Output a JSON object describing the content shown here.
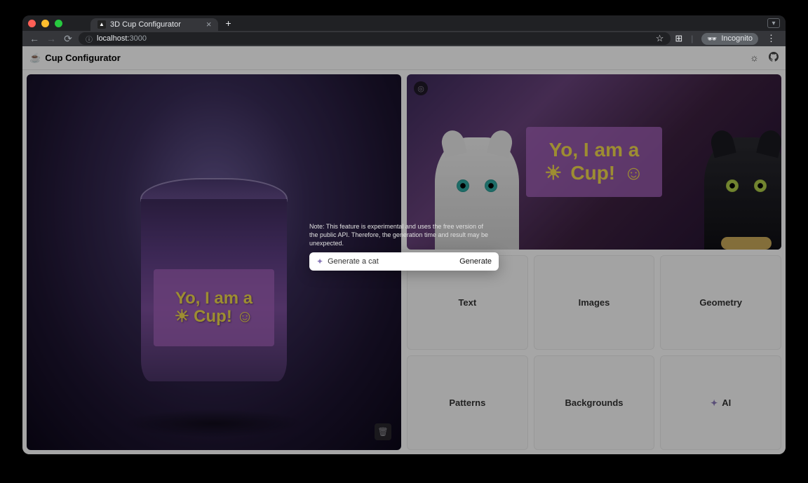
{
  "browser": {
    "tab_title": "3D Cup Configurator",
    "url_host": "localhost:",
    "url_port": "3000",
    "incognito_label": "Incognito"
  },
  "app": {
    "title": "Cup Configurator",
    "cup_text_line1": "Yo, I am a",
    "cup_text_line2": "Cup!",
    "flat_text_line1": "Yo, I am a",
    "flat_text_line2": "Cup!",
    "sun_emoji": "☀",
    "smile_emoji": "☺"
  },
  "tools": {
    "items": [
      "Text",
      "Images",
      "Geometry",
      "Patterns",
      "Backgrounds",
      "AI"
    ]
  },
  "modal": {
    "note": "Note: This feature is experimental and uses the free version of the public API. Therefore, the generation time and result may be unexpected.",
    "input_value": "Generate a cat",
    "generate_label": "Generate"
  }
}
